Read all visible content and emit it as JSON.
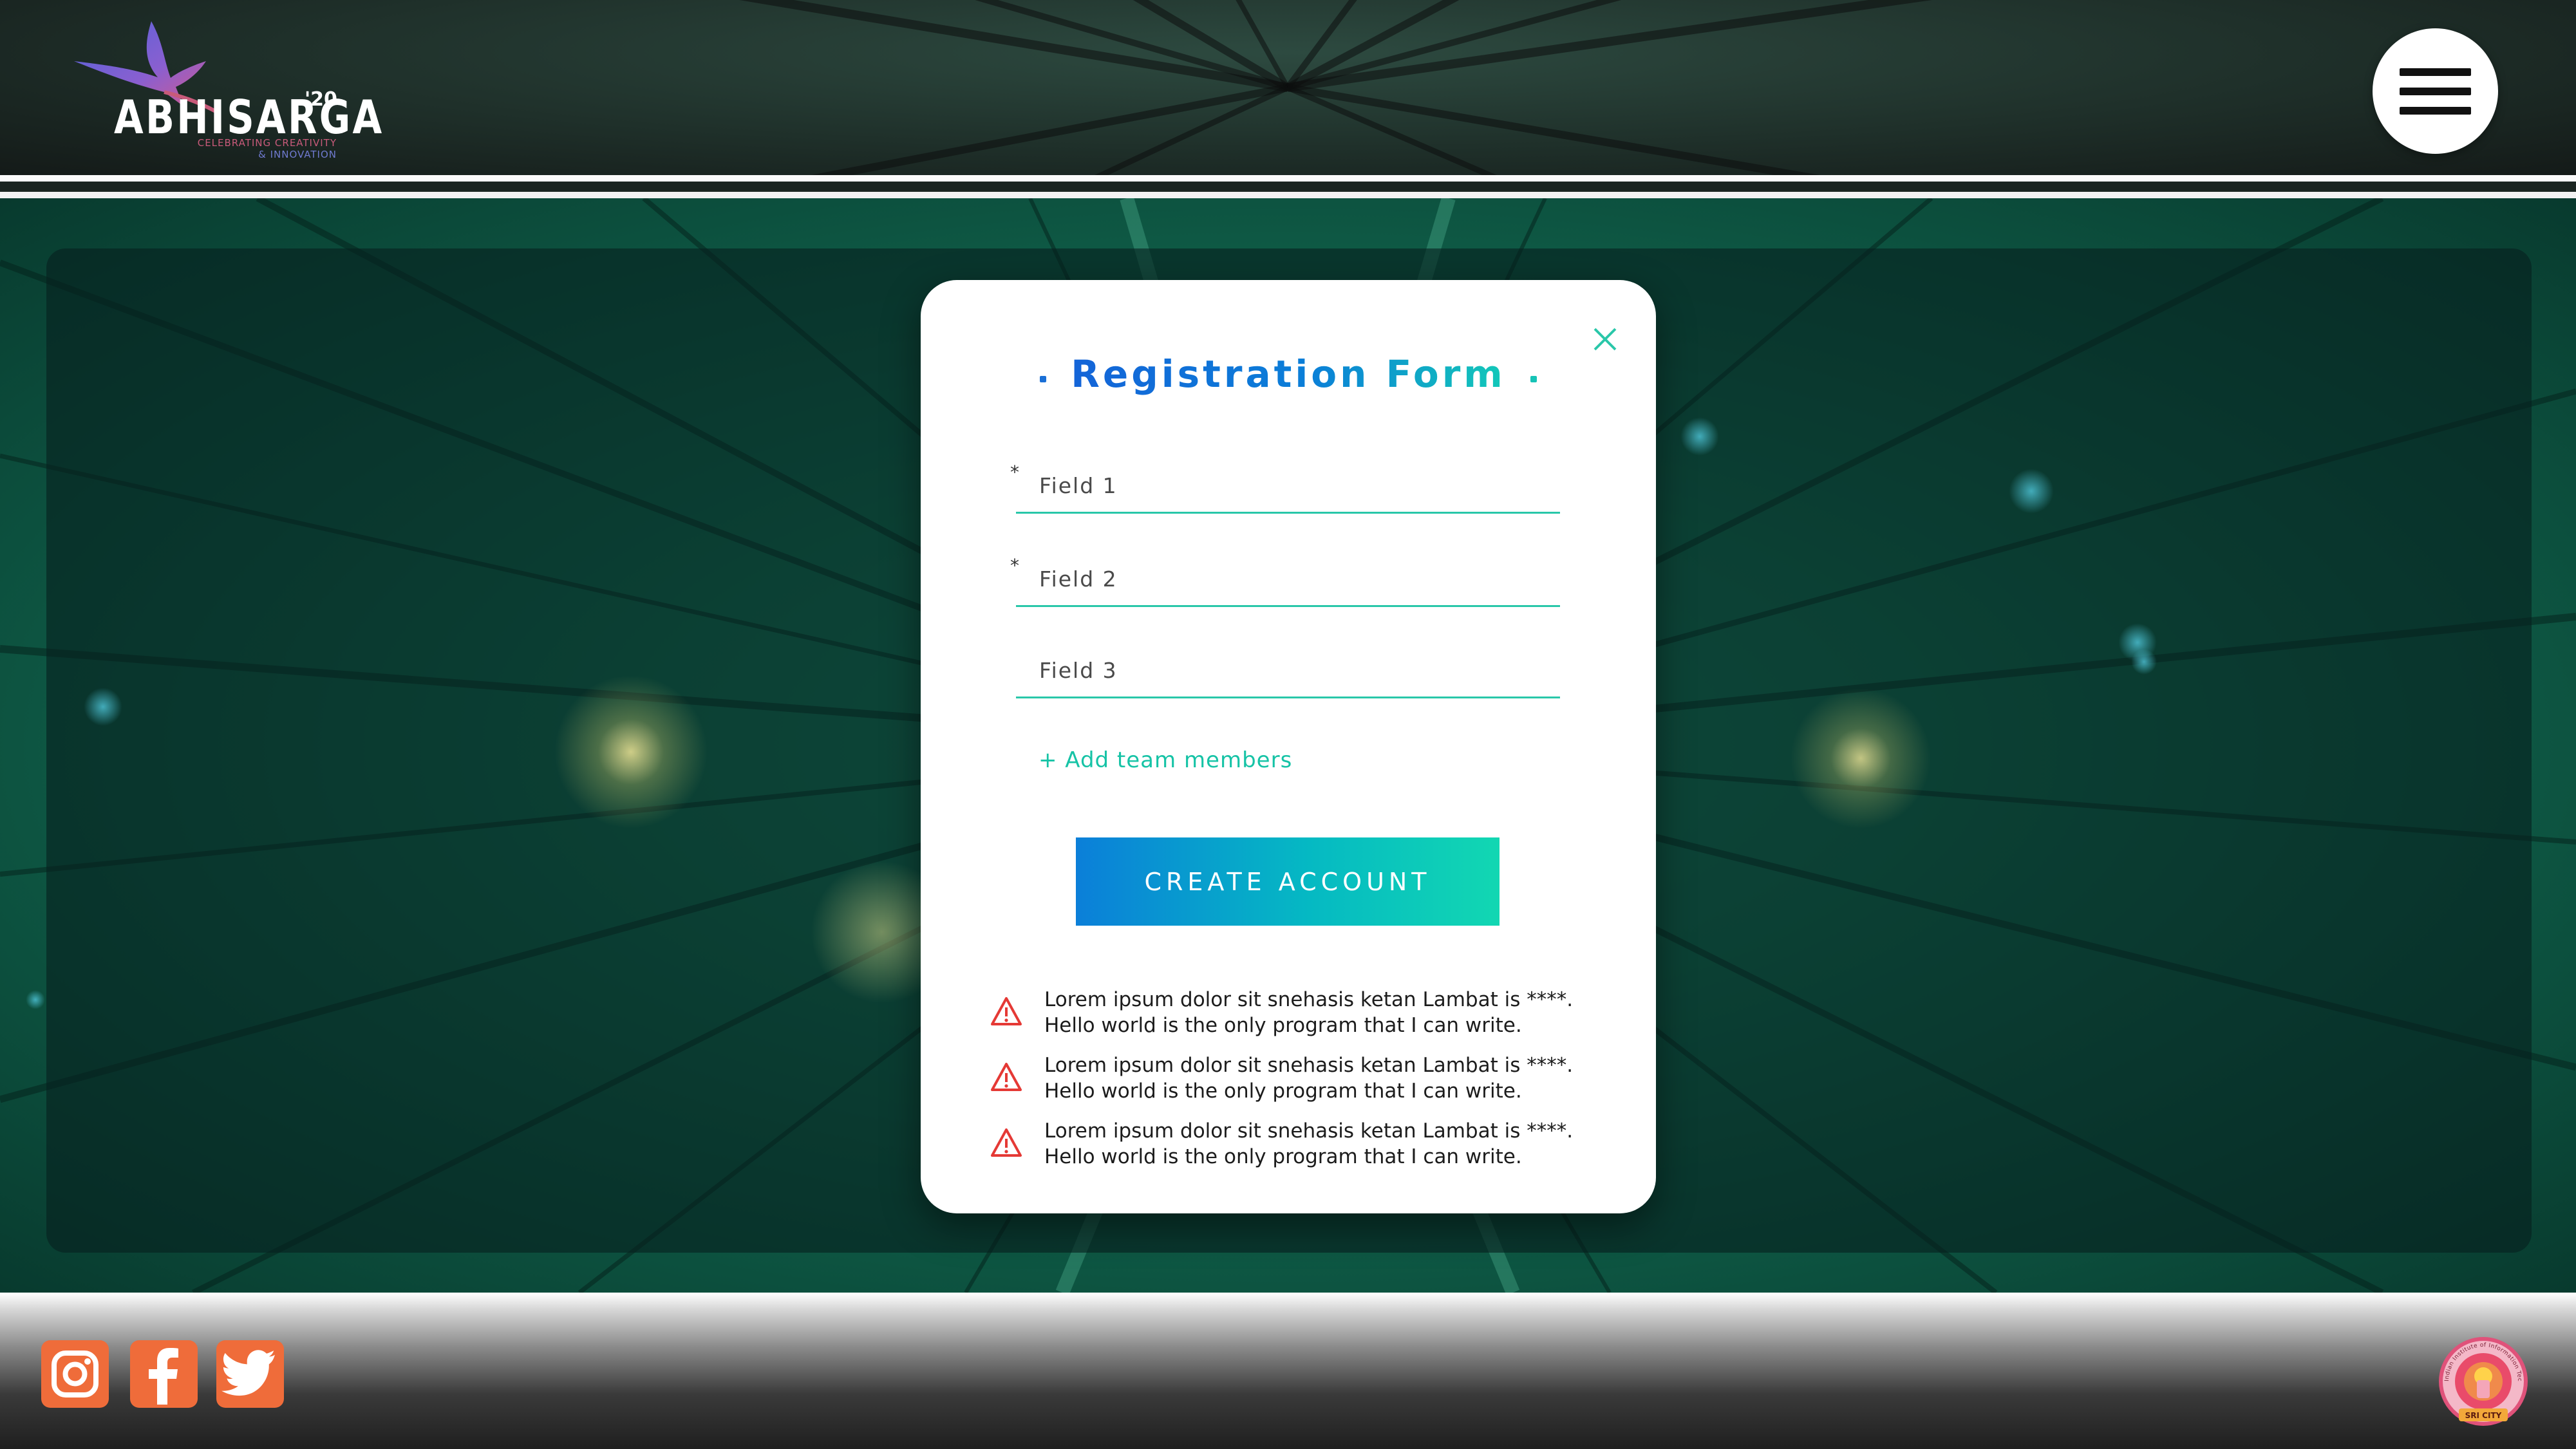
{
  "header": {
    "logo": {
      "wordmark": "ABHISARGA",
      "year": "'20",
      "tagline_line1": "CELEBRATING CREATIVITY",
      "tagline_line2": "& INNOVATION"
    },
    "menu_icon": "hamburger-icon"
  },
  "modal": {
    "title": "Registration Form",
    "close_icon": "close-icon",
    "fields": [
      {
        "placeholder": "Field 1",
        "value": "",
        "required": true
      },
      {
        "placeholder": "Field 2",
        "value": "",
        "required": true
      },
      {
        "placeholder": "Field 3",
        "value": "",
        "required": false
      }
    ],
    "required_marker": "*",
    "add_team_label": "+ Add team members",
    "create_button_label": "CREATE ACCOUNT",
    "alerts": [
      {
        "icon": "warning-triangle-icon",
        "line1": "Lorem ipsum dolor sit snehasis ketan Lambat is ****.",
        "line2": "Hello world is the only program that I can write."
      },
      {
        "icon": "warning-triangle-icon",
        "line1": "Lorem ipsum dolor sit snehasis ketan Lambat is ****.",
        "line2": "Hello world is the only program that I can write."
      },
      {
        "icon": "warning-triangle-icon",
        "line1": "Lorem ipsum dolor sit snehasis ketan Lambat is ****.",
        "line2": "Hello world is the only program that I can write."
      }
    ]
  },
  "footer": {
    "social": [
      "instagram-icon",
      "facebook-icon",
      "twitter-icon"
    ],
    "seal": {
      "ring_text": "Indian Institute of Information Technology, Sri City, Chittoor",
      "banner": "SRI CITY"
    }
  },
  "colors": {
    "accent_teal": "#16c3a6",
    "accent_blue": "#0b7fd9",
    "alert_red": "#e53935",
    "social_orange": "#ef6c3a"
  }
}
